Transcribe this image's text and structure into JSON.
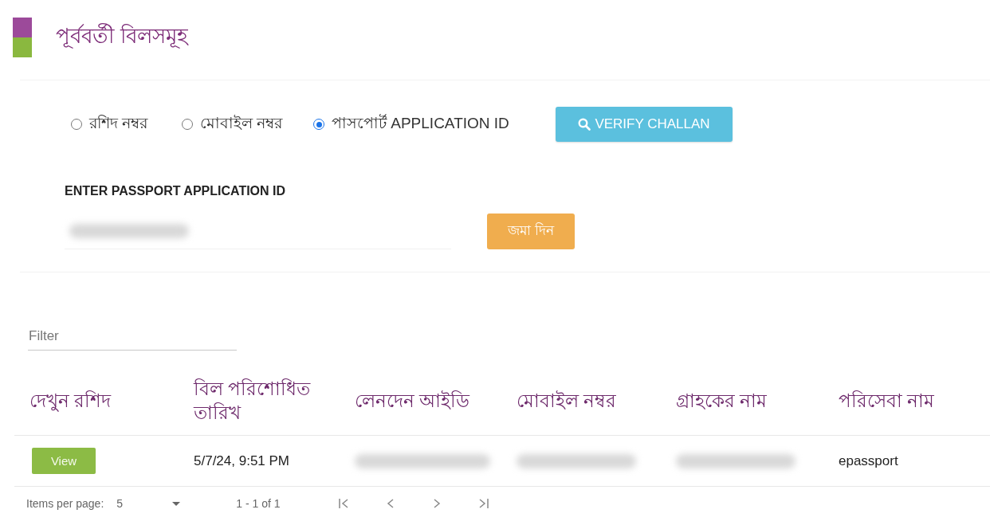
{
  "header": {
    "title": "পূর্ববর্তী বিলসমূহ"
  },
  "search_options": [
    {
      "label": "রশিদ নম্বর",
      "selected": false
    },
    {
      "label": "মোবাইল নম্বর",
      "selected": false
    },
    {
      "label": "পাসপোর্ট APPLICATION ID",
      "selected": true
    }
  ],
  "verify_button": {
    "label": "VERIFY CHALLAN"
  },
  "id_field": {
    "label": "ENTER PASSPORT APPLICATION ID",
    "value_redacted": true
  },
  "submit_button": {
    "label": "জমা দিন"
  },
  "filter": {
    "placeholder": "Filter"
  },
  "table": {
    "columns": [
      "দেখুন রশিদ",
      "বিল পরিশোধিত তারিখ",
      "লেনদেন আইডি",
      "মোবাইল নম্বর",
      "গ্রাহকের নাম",
      "পরিসেবা নাম"
    ],
    "rows": [
      {
        "cells": [
          {
            "kind": "button",
            "text": "View"
          },
          {
            "kind": "text",
            "text": "5/7/24, 9:51 PM"
          },
          {
            "kind": "redacted"
          },
          {
            "kind": "redacted"
          },
          {
            "kind": "redacted"
          },
          {
            "kind": "text",
            "text": "epassport"
          }
        ]
      }
    ]
  },
  "paginator": {
    "label": "Items per page:",
    "page_size": "5",
    "range": "1 - 1 of 1"
  }
}
